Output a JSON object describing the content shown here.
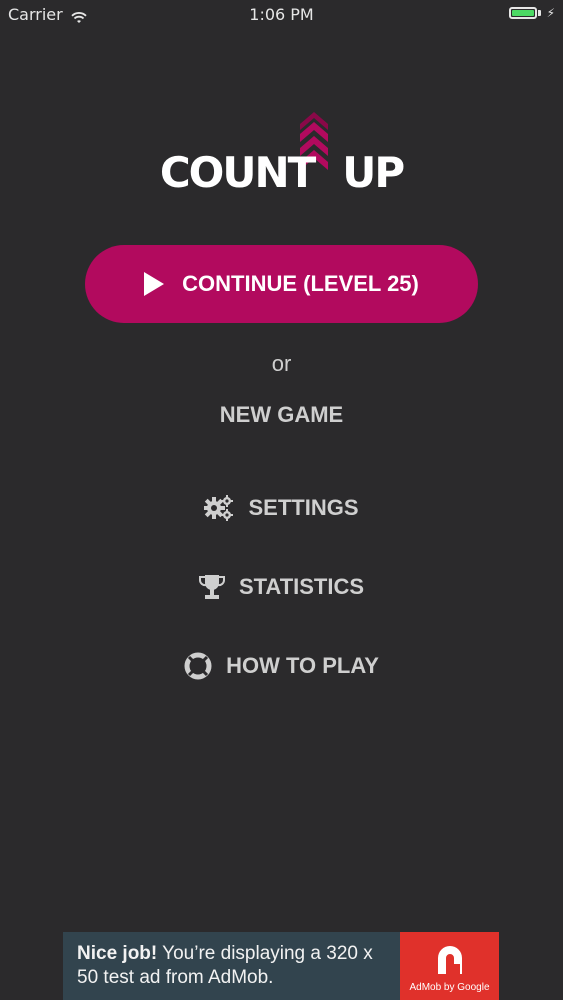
{
  "status_bar": {
    "carrier": "Carrier",
    "time": "1:06 PM"
  },
  "logo": {
    "text_left": "COUNT",
    "text_right": "UP",
    "accent_color": "#b20a5e"
  },
  "continue_button": {
    "label": "CONTINUE (LEVEL 25)",
    "color": "#b20a5e"
  },
  "or_label": "or",
  "menu": {
    "new_game": "NEW GAME",
    "settings": "SETTINGS",
    "statistics": "STATISTICS",
    "how_to_play": "HOW TO PLAY"
  },
  "icons": {
    "settings": "gears-icon",
    "statistics": "trophy-icon",
    "how_to_play": "lifebuoy-icon",
    "continue": "play-icon"
  },
  "ad": {
    "headline": "Nice job!",
    "body": "You’re displaying a 320 x 50 test ad from AdMob.",
    "brand": "AdMob by Google"
  }
}
